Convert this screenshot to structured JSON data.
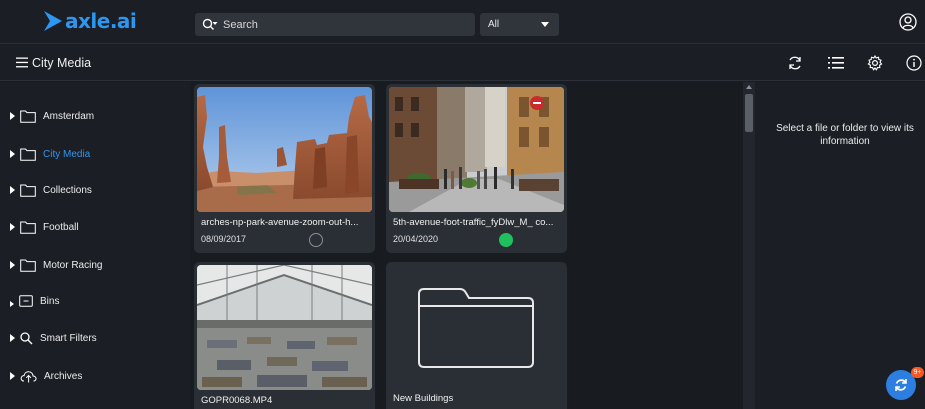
{
  "app": {
    "logo_text": "axle.ai"
  },
  "header": {
    "search_placeholder": "Search",
    "search_value": "",
    "scope_selected": "All"
  },
  "subbar": {
    "title": "City Media"
  },
  "sidebar": {
    "items": [
      {
        "label": "Amsterdam",
        "icon": "folder-icon"
      },
      {
        "label": "City Media",
        "icon": "folder-icon",
        "active": true
      },
      {
        "label": "Collections",
        "icon": "folder-icon"
      },
      {
        "label": "Football",
        "icon": "folder-icon"
      },
      {
        "label": "Motor Racing",
        "icon": "folder-icon"
      },
      {
        "label": "Bins",
        "icon": "bin-icon"
      },
      {
        "label": "Smart Filters",
        "icon": "search-icon"
      },
      {
        "label": "Archives",
        "icon": "cloud-upload-icon"
      }
    ]
  },
  "cards": [
    {
      "name": "arches-np-park-avenue-zoom-out-h...",
      "date": "08/09/2017",
      "status": "none"
    },
    {
      "name": "5th-avenue-foot-traffic_fyDlw_M_ co...",
      "date": "20/04/2020",
      "status": "online"
    },
    {
      "name": "GOPR0068.MP4",
      "date": ""
    },
    {
      "name": "New Buildings",
      "type": "folder"
    }
  ],
  "info_panel": {
    "message": "Select a file or folder to view its information"
  },
  "notification_badge": "9+",
  "colors": {
    "accent": "#2c97f0",
    "status_online": "#1fc15e",
    "background": "#181b20",
    "panel": "#1b1e24",
    "card": "#2a2e35"
  }
}
